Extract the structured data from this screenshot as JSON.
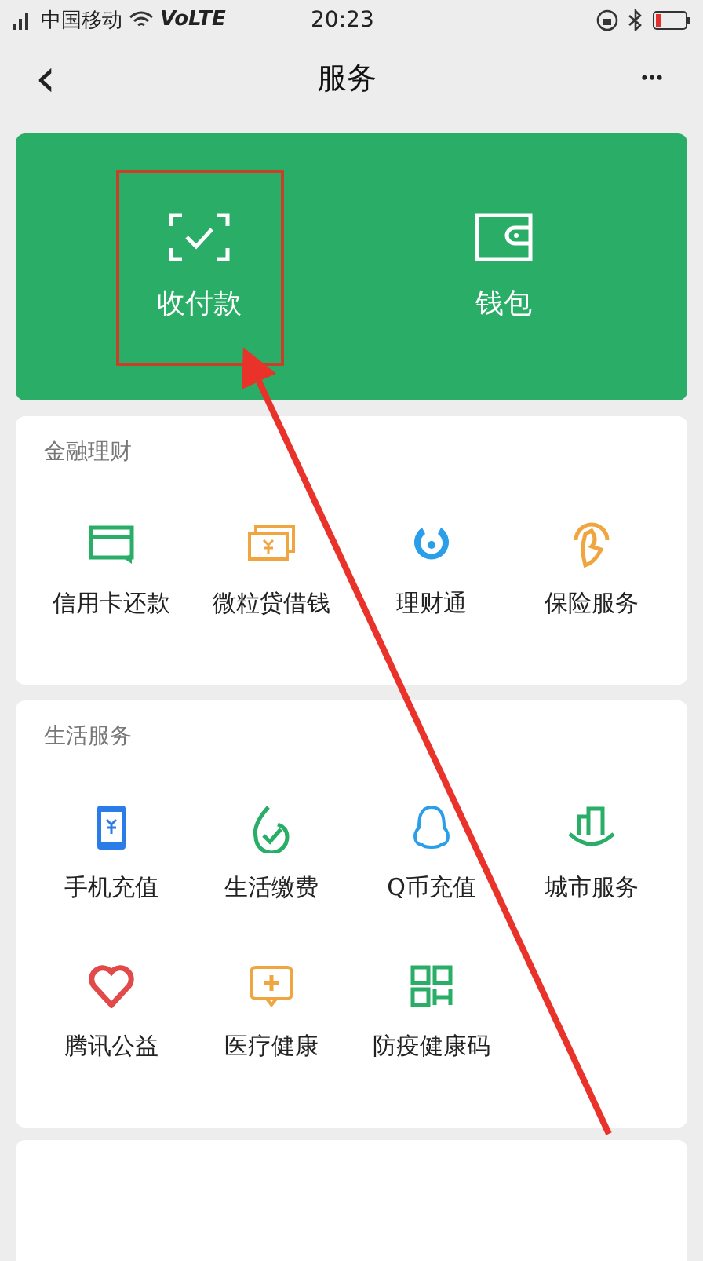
{
  "status_bar": {
    "carrier": "中国移动",
    "network": "VoLTE",
    "time": "20:23"
  },
  "header": {
    "back": "‹",
    "title": "服务",
    "more": "•••"
  },
  "top_card": {
    "items": [
      {
        "label": "收付款",
        "highlighted": true
      },
      {
        "label": "钱包",
        "highlighted": false
      }
    ]
  },
  "sections": [
    {
      "title": "金融理财",
      "items": [
        "信用卡还款",
        "微粒贷借钱",
        "理财通",
        "保险服务"
      ]
    },
    {
      "title": "生活服务",
      "items": [
        "手机充值",
        "生活缴费",
        "Q币充值",
        "城市服务",
        "腾讯公益",
        "医疗健康",
        "防疫健康码"
      ]
    }
  ],
  "annotation": {
    "arrow": true
  }
}
